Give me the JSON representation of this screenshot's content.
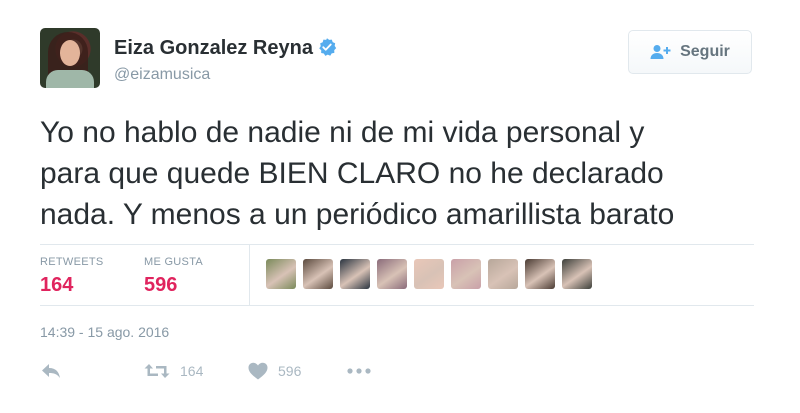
{
  "user": {
    "display_name": "Eiza Gonzalez Reyna",
    "handle": "@eizamusica",
    "verified_icon": "verified-badge-icon"
  },
  "follow_button": {
    "label": "Seguir",
    "icon": "add-user-icon"
  },
  "tweet": {
    "text_lines": [
      "Yo no hablo de nadie ni de mi vida personal y",
      "para que quede BIEN CLARO no he declarado",
      "nada. Y menos a un periódico amarillista barato"
    ]
  },
  "stats": {
    "retweets_label": "RETWEETS",
    "retweets_value": "164",
    "likes_label": "ME GUSTA",
    "likes_value": "596"
  },
  "likers": [
    {
      "name": "liker-avatar-1",
      "color": "#7a8a5a"
    },
    {
      "name": "liker-avatar-2",
      "color": "#5b4a3e"
    },
    {
      "name": "liker-avatar-3",
      "color": "#2a3440"
    },
    {
      "name": "liker-avatar-4",
      "color": "#8a6b7a"
    },
    {
      "name": "liker-avatar-5",
      "color": "#e9c7b8"
    },
    {
      "name": "liker-avatar-6",
      "color": "#c9a0a8"
    },
    {
      "name": "liker-avatar-7",
      "color": "#b7a79a"
    },
    {
      "name": "liker-avatar-8",
      "color": "#4a3b33"
    },
    {
      "name": "liker-avatar-9",
      "color": "#3c3f3a"
    }
  ],
  "timestamp": "14:39 - 15 ago. 2016",
  "actions": {
    "reply_icon": "reply-icon",
    "retweet_icon": "retweet-icon",
    "retweet_count": "164",
    "like_icon": "heart-icon",
    "like_count": "596",
    "more_icon": "more-dots-icon"
  },
  "colors": {
    "text": "#292f33",
    "muted": "#8899a6",
    "accent_blue": "#55acee",
    "like_pink": "#e0245e",
    "divider": "#e1e8ed"
  }
}
